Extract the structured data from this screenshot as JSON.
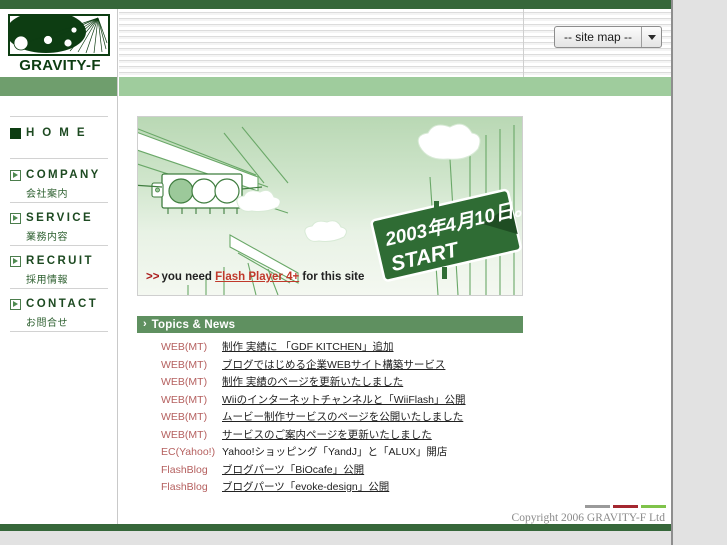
{
  "site": {
    "logo_text": "GRAVITY-F",
    "logo_icon": "gravity-orbit-logo"
  },
  "header": {
    "sitemap_select": {
      "selected": "-- site map --",
      "caret_icon": "chevron-down-icon"
    }
  },
  "sidebar": {
    "items": [
      {
        "en": "H O M E",
        "ja": "",
        "icon": "solid-square-icon",
        "active": true
      },
      {
        "en": "COMPANY",
        "ja": "会社案内",
        "icon": "arrow-square-icon",
        "active": false
      },
      {
        "en": "SERVICE",
        "ja": "業務内容",
        "icon": "arrow-square-icon",
        "active": false
      },
      {
        "en": "RECRUIT",
        "ja": "採用情報",
        "icon": "arrow-square-icon",
        "active": false
      },
      {
        "en": "CONTACT",
        "ja": "お問合せ",
        "icon": "arrow-square-icon",
        "active": false
      }
    ]
  },
  "banner": {
    "sign_line1": "2003年4月10日。",
    "sign_line2": "START",
    "note_prefix": ">>",
    "note_before": "you need ",
    "note_link": "Flash Player 4+",
    "note_after": " for this site"
  },
  "topics": {
    "heading": "Topics & News",
    "chevron": "›",
    "rows": [
      {
        "category": "WEB(MT)",
        "title": "制作 実績に 「GDF KITCHEN」追加",
        "linked": true
      },
      {
        "category": "WEB(MT)",
        "title": "ブログではじめる企業WEBサイト構築サービス",
        "linked": true
      },
      {
        "category": "WEB(MT)",
        "title": "制作 実績のページを更新いたしました",
        "linked": true
      },
      {
        "category": "WEB(MT)",
        "title": "Wiiのインターネットチャンネルと「WiiFlash」公開",
        "linked": true
      },
      {
        "category": "WEB(MT)",
        "title": "ムービー制作サービスのページを公開いたしました",
        "linked": true
      },
      {
        "category": "WEB(MT)",
        "title": "サービスのご案内ページを更新いたしました",
        "linked": true
      },
      {
        "category": "EC(Yahoo!)",
        "title": "Yahoo!ショッピング「YandJ」と「ALUX」開店",
        "linked": false
      },
      {
        "category": "FlashBlog",
        "title": "ブログパーツ「BiOcafe」公開",
        "linked": true
      },
      {
        "category": "FlashBlog",
        "title": "ブログパーツ「evoke-design」公開",
        "linked": true
      }
    ]
  },
  "footer": {
    "copyright": "Copyright 2006 GRAVITY-F Ltd",
    "bars": [
      "#9a9a9a",
      "#a42830",
      "#7fc34a"
    ]
  },
  "colors": {
    "brand_dark_green": "#36673a",
    "brand_green": "#5f9060",
    "band_left": "#6f9e6d",
    "band_right": "#9fcc9d",
    "nav_text": "#1d4a21",
    "news_category": "#b5605f",
    "link_red": "#c0392b"
  }
}
